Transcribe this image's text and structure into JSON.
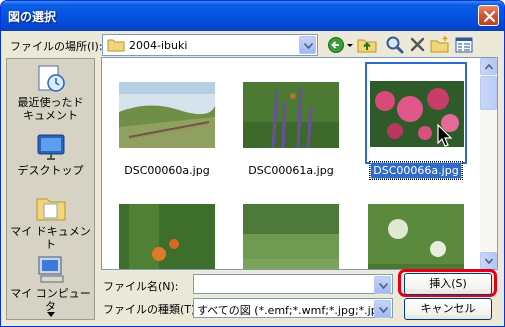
{
  "window": {
    "title": "図の選択"
  },
  "toolbar": {
    "look_in_label": "ファイルの場所(I):",
    "look_in_value": "2004-ibuki",
    "icons": [
      "back-icon",
      "up-folder-icon",
      "search-web-icon",
      "delete-icon",
      "new-folder-icon",
      "views-icon"
    ]
  },
  "places": [
    {
      "label_line1": "最近使ったド",
      "label_line2": "キュメント",
      "icon": "recent-documents-icon"
    },
    {
      "label_line1": "デスクトップ",
      "label_line2": "",
      "icon": "desktop-icon"
    },
    {
      "label_line1": "マイ ドキュメント",
      "label_line2": "",
      "icon": "my-documents-icon"
    },
    {
      "label_line1": "マイ コンピュータ",
      "label_line2": "",
      "icon": "my-computer-icon"
    }
  ],
  "files": [
    {
      "name": "DSC00060a.jpg",
      "selected": false
    },
    {
      "name": "DSC00061a.jpg",
      "selected": false
    },
    {
      "name": "DSC00066a.jpg",
      "selected": true
    },
    {
      "name": "",
      "selected": false
    },
    {
      "name": "",
      "selected": false
    },
    {
      "name": "",
      "selected": false
    }
  ],
  "filename": {
    "label": "ファイル名(N):",
    "value": ""
  },
  "filetype": {
    "label": "ファイルの種類(T):",
    "value": "すべての図 (*.emf;*.wmf;*.jpg;*.jpeg;*."
  },
  "buttons": {
    "insert": "挿入(S)",
    "cancel": "キャンセル"
  },
  "colors": {
    "title_bar": "#0554e3",
    "selection": "#316ac5",
    "highlight_ring": "#e4001a"
  }
}
